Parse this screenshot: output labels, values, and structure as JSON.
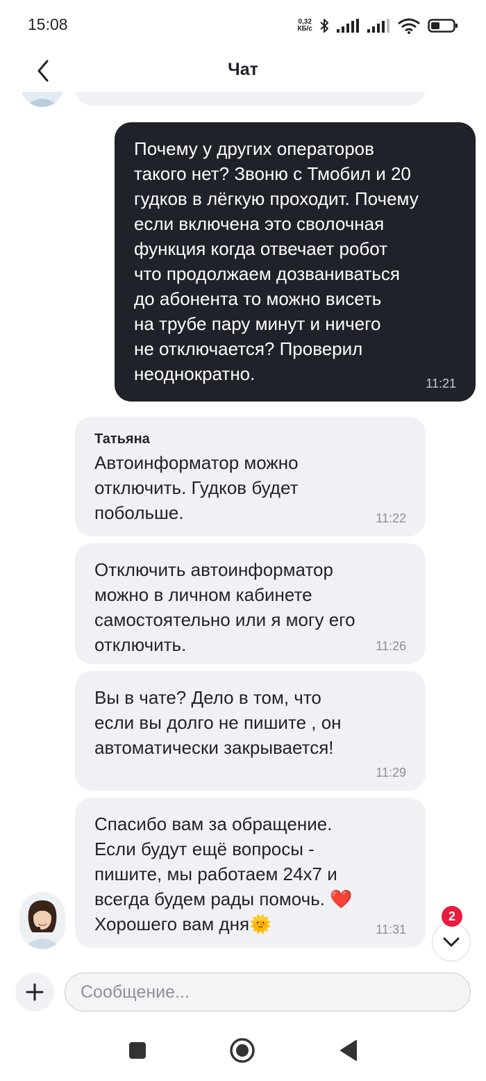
{
  "status_bar": {
    "time": "15:08",
    "net_speed_value": "0,32",
    "net_speed_unit": "КБ/с",
    "battery_level": 0.4
  },
  "header": {
    "title": "Чат"
  },
  "messages": [
    {
      "direction": "outgoing",
      "text": "Почему у других операторов\nтакого нет? Звоню с Тмобил и 20\nгудков в лёгкую проходит. Почему\nесли включена это сволочная\nфункция когда отвечает робот\nчто продолжаем дозваниваться\nдо абонента то можно висеть\nна трубе пару минут и ничего\nне отключается? Проверил\nнеоднократно.",
      "time": "11:21"
    },
    {
      "direction": "incoming",
      "sender": "Татьяна",
      "text": "Автоинформатор можно\nотключить. Гудков будет\nпобольше.",
      "time": "11:22"
    },
    {
      "direction": "incoming",
      "text": "Отключить автоинформатор\nможно в личном кабинете\nсамостоятельно или я могу его\nотключить.",
      "time": "11:26"
    },
    {
      "direction": "incoming",
      "text": "Вы в чате? Дело в том, что\nесли вы долго не пишите , он\nавтоматически закрывается!",
      "time": "11:29"
    },
    {
      "direction": "incoming",
      "text": "Спасибо вам за обращение.\nЕсли будут ещё вопросы -\nпишите, мы работаем 24x7 и\nвсегда будем рады помочь. ❤️\nХорошего вам дня🌞",
      "time": "11:31"
    }
  ],
  "scroll_down": {
    "unread_count": "2"
  },
  "composer": {
    "placeholder": "Сообщение..."
  },
  "colors": {
    "outgoing_bubble": "#1f2229",
    "incoming_bubble": "#f1f1f5",
    "badge": "#ea1c3d"
  }
}
